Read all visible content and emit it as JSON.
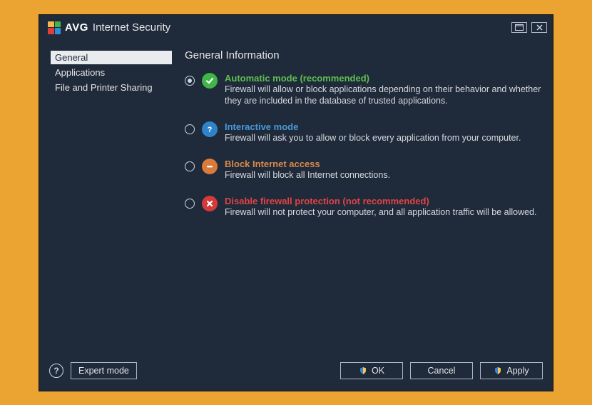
{
  "app": {
    "brand": "AVG",
    "title": "Internet Security"
  },
  "sidebar": {
    "items": [
      {
        "label": "General",
        "selected": true
      },
      {
        "label": "Applications",
        "selected": false
      },
      {
        "label": "File and Printer Sharing",
        "selected": false
      }
    ]
  },
  "main": {
    "heading": "General Information",
    "options": [
      {
        "id": "automatic",
        "title": "Automatic mode (recommended)",
        "desc": "Firewall will allow or block applications depending on their behavior and whether they are included in the database of trusted applications.",
        "selected": true,
        "icon": "check-icon",
        "title_color": "t-green",
        "icon_color": "ic-green"
      },
      {
        "id": "interactive",
        "title": "Interactive mode",
        "desc": "Firewall will ask you to allow or block every application from your computer.",
        "selected": false,
        "icon": "question-icon",
        "title_color": "t-blue",
        "icon_color": "ic-blue"
      },
      {
        "id": "block",
        "title": "Block Internet access",
        "desc": "Firewall will block all Internet connections.",
        "selected": false,
        "icon": "minus-icon",
        "title_color": "t-orange",
        "icon_color": "ic-orange"
      },
      {
        "id": "disable",
        "title": "Disable firewall protection (not recommended)",
        "desc": "Firewall will not protect your computer, and all application traffic will be allowed.",
        "selected": false,
        "icon": "cross-icon",
        "title_color": "t-red",
        "icon_color": "ic-red"
      }
    ]
  },
  "footer": {
    "expert_mode": "Expert mode",
    "ok": "OK",
    "cancel": "Cancel",
    "apply": "Apply"
  }
}
